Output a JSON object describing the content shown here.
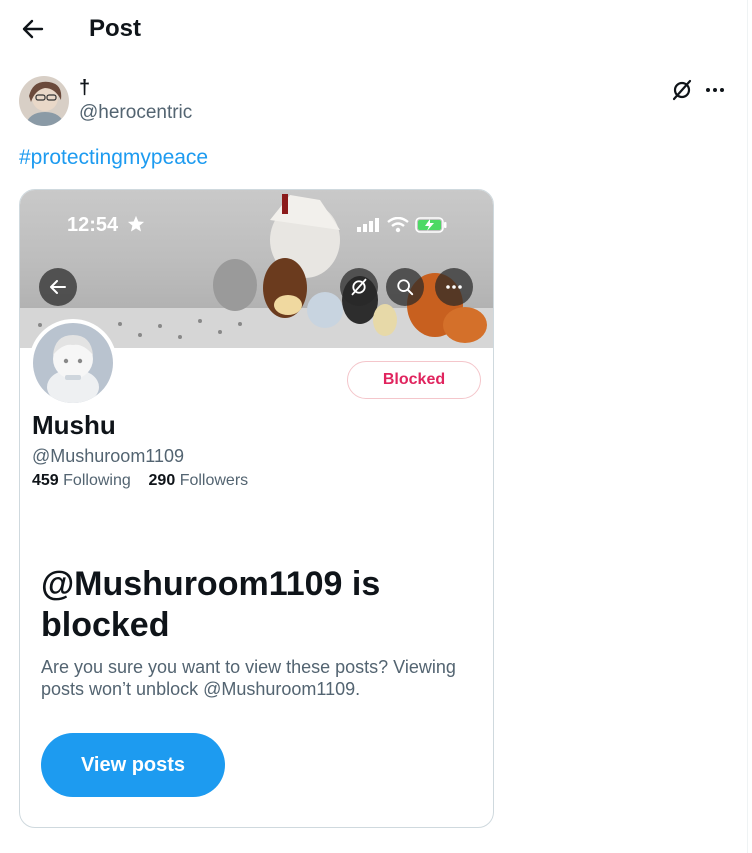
{
  "header": {
    "title": "Post"
  },
  "post": {
    "author": {
      "display_name": "†",
      "handle": "@herocentric"
    },
    "hashtag": "#protectingmypeace"
  },
  "embedded_screenshot": {
    "status_bar": {
      "time": "12:54"
    },
    "profile": {
      "name": "Mushu",
      "handle": "@Mushuroom1109",
      "following_count": "459",
      "following_label": "Following",
      "followers_count": "290",
      "followers_label": "Followers",
      "relationship_label": "Blocked"
    },
    "block_notice": {
      "title": "@Mushuroom1109 is blocked",
      "description": "Are you sure you want to view these posts? Viewing posts won’t unblock @Mushuroom1109.",
      "button_label": "View posts"
    }
  },
  "colors": {
    "accent": "#1d9bf0",
    "blocked_red": "#e0245e",
    "secondary_text": "#536471"
  }
}
